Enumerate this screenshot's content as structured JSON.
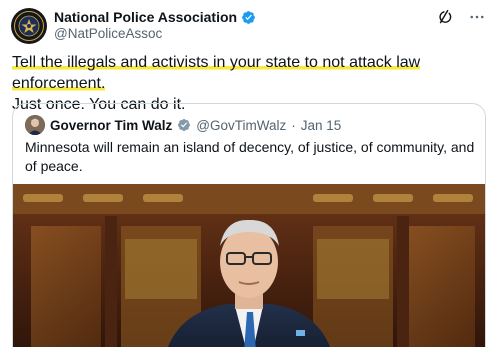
{
  "post": {
    "author_name": "National Police Association",
    "author_handle": "@NatPoliceAssoc",
    "text_highlighted": "Tell the illegals and activists in your state to not attack law enforcement.",
    "text_rest": "Just once. You can do it.",
    "avatar_icon": "police-seal-icon",
    "verified_icon": "verified-badge-icon",
    "actions": [
      "grok-icon",
      "more-icon"
    ]
  },
  "quote": {
    "author_name": "Governor Tim Walz",
    "author_handle": "@GovTimWalz",
    "separator": "·",
    "date": "Jan 15",
    "text": "Minnesota will remain an island of decency, of justice, of community, and of peace.",
    "media": "video-thumbnail"
  },
  "colors": {
    "text": "#0f1419",
    "secondary": "#536471",
    "verified_blue": "#1d9bf0",
    "verified_gray": "#829aab",
    "highlight": "#f7ea3a",
    "border": "#cfd9de"
  }
}
